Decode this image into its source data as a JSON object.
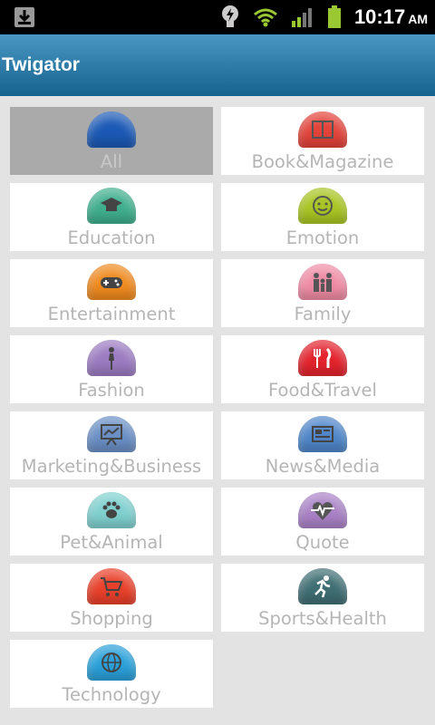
{
  "status_bar": {
    "time": "10:17",
    "ampm": "AM",
    "icons": [
      "download-icon",
      "lightbulb-icon",
      "wifi-icon",
      "signal-icon",
      "battery-icon"
    ]
  },
  "app": {
    "title": "Twigator"
  },
  "categories": [
    {
      "label": "All",
      "color": "#1c59b5",
      "icon": "all-icon",
      "selected": true
    },
    {
      "label": "Book&Magazine",
      "color": "#e2433a",
      "icon": "book-icon"
    },
    {
      "label": "Education",
      "color": "#3fae8c",
      "icon": "graduation-cap-icon"
    },
    {
      "label": "Emotion",
      "color": "#a8c422",
      "icon": "smiley-icon"
    },
    {
      "label": "Entertainment",
      "color": "#ef8a1f",
      "icon": "gamepad-icon"
    },
    {
      "label": "Family",
      "color": "#ef8ca5",
      "icon": "family-icon"
    },
    {
      "label": "Fashion",
      "color": "#9b7bc1",
      "icon": "fashion-icon"
    },
    {
      "label": "Food&Travel",
      "color": "#e3232e",
      "icon": "fork-knife-icon"
    },
    {
      "label": "Marketing&Business",
      "color": "#6a8fc5",
      "icon": "presentation-icon"
    },
    {
      "label": "News&Media",
      "color": "#4f86c9",
      "icon": "newspaper-icon"
    },
    {
      "label": "Pet&Animal",
      "color": "#7fd0cf",
      "icon": "paw-icon"
    },
    {
      "label": "Quote",
      "color": "#a982c6",
      "icon": "heartbeat-icon"
    },
    {
      "label": "Shopping",
      "color": "#e8402a",
      "icon": "cart-icon"
    },
    {
      "label": "Sports&Health",
      "color": "#3f6e73",
      "icon": "runner-icon"
    },
    {
      "label": "Technology",
      "color": "#2aa0d9",
      "icon": "globe-icon"
    }
  ]
}
